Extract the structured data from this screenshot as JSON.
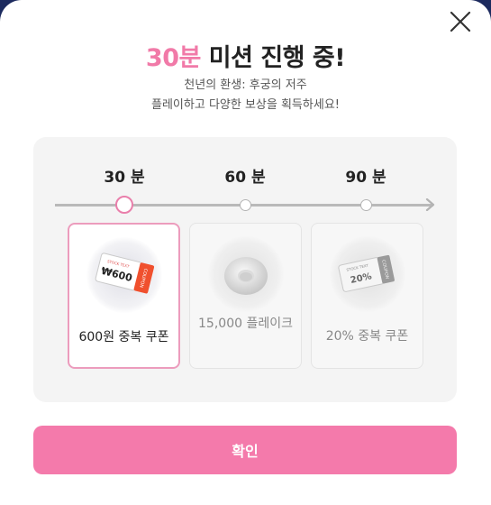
{
  "modal": {
    "title_accent": "30분",
    "title_rest": " 미션 진행 중!",
    "subtitle_line1": "천년의 환생: 후궁의 저주",
    "subtitle_line2": "플레이하고 다양한 보상을 획득하세요!"
  },
  "timeline": {
    "labels": [
      "30 분",
      "60 분",
      "90 분"
    ],
    "current_step": 1
  },
  "rewards": [
    {
      "label": "600원 중복 쿠폰",
      "coupon_text": "₩600",
      "coupon_side": "COUPON",
      "coupon_top": "STOCK TEXT",
      "icon": "coupon-icon",
      "active": true
    },
    {
      "label": "15,000 플레이크",
      "icon": "flake-ring-icon",
      "active": false
    },
    {
      "label": "20% 중복 쿠폰",
      "coupon_text": "20%",
      "coupon_side": "COUPON",
      "coupon_top": "STOCK TEXT",
      "icon": "coupon-icon",
      "active": false
    }
  ],
  "footer": {
    "confirm_label": "확인"
  },
  "colors": {
    "accent": "#f17aa8",
    "button": "#f47aab",
    "panel": "#f4f4f4"
  }
}
